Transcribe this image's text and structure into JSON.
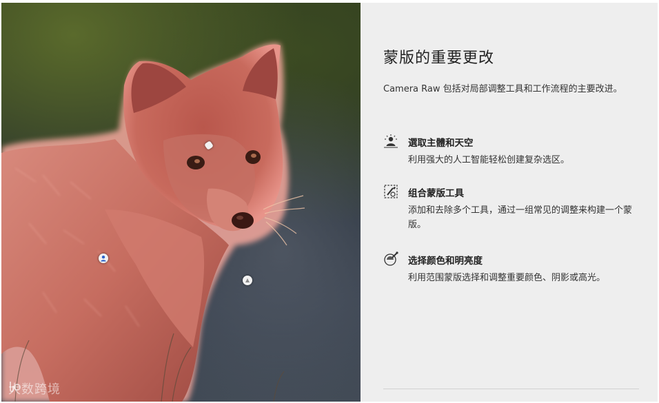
{
  "info_panel": {
    "title": "蒙版的重要更改",
    "intro": "Camera Raw 包括对局部调整工具和工作流程的主要改进。",
    "features": [
      {
        "icon": "select-subject-sky-icon",
        "title": "選取主體和天空",
        "description": "利用强大的人工智能轻松创建复杂选区。"
      },
      {
        "icon": "combine-mask-tools-icon",
        "title": "组合蒙版工具",
        "description": "添加和去除多个工具，通过一组常见的调整来构建一个蒙版。"
      },
      {
        "icon": "color-luminance-range-icon",
        "title": "选择颜色和明亮度",
        "description": "利用范围蒙版选择和调整重要颜色、阴影或高光。"
      }
    ]
  },
  "photo": {
    "subject": "fox",
    "mask_overlay_color": "#e0706a",
    "pins": [
      "brush-pin-icon",
      "person-pin-icon",
      "gradient-pin-icon"
    ]
  },
  "watermark": {
    "text": "大数跨境"
  }
}
